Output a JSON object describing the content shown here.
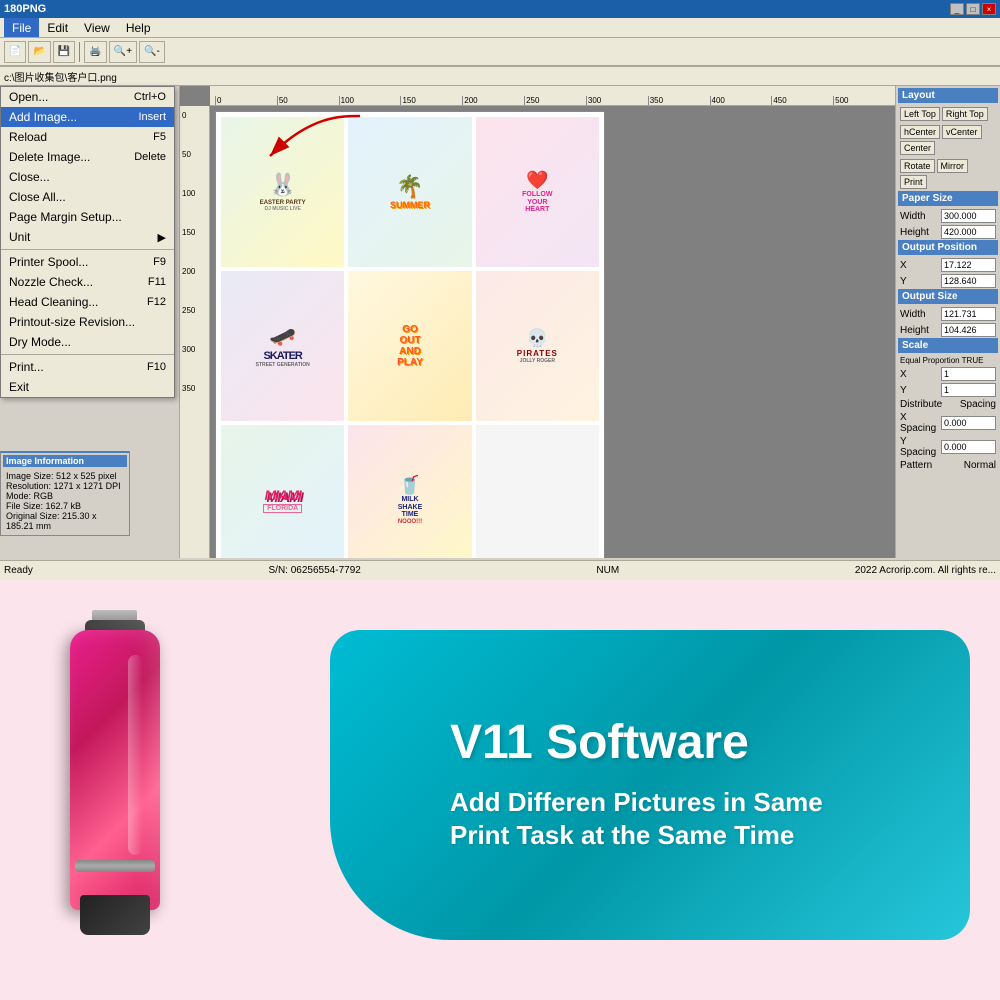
{
  "app": {
    "title": "180PNG",
    "window_controls": [
      "_",
      "□",
      "×"
    ]
  },
  "menu": {
    "items": [
      "File",
      "Edit",
      "View",
      "Help"
    ],
    "active": "File"
  },
  "dropdown": {
    "items": [
      {
        "label": "Open...",
        "shortcut": "Ctrl+O"
      },
      {
        "label": "Add Image...",
        "shortcut": "Insert",
        "highlighted": true
      },
      {
        "label": "Reload",
        "shortcut": "F5"
      },
      {
        "label": "Delete Image...",
        "shortcut": "Delete"
      },
      {
        "label": "Close...",
        "shortcut": ""
      },
      {
        "label": "Close All...",
        "shortcut": ""
      },
      {
        "label": "Page Margin Setup...",
        "shortcut": ""
      },
      {
        "label": "Unit",
        "shortcut": "▶"
      },
      {
        "separator": true
      },
      {
        "label": "Printer Spool...",
        "shortcut": "F9"
      },
      {
        "label": "Nozzle Check...",
        "shortcut": "F11"
      },
      {
        "label": "Head Cleaning...",
        "shortcut": "F12"
      },
      {
        "label": "Printout-size Revision...",
        "shortcut": ""
      },
      {
        "label": "Dry Mode...",
        "shortcut": ""
      },
      {
        "separator": true
      },
      {
        "label": "Print...",
        "shortcut": "F10"
      },
      {
        "label": "Exit",
        "shortcut": ""
      }
    ]
  },
  "right_panel": {
    "layout_section": "Layout",
    "layout_buttons": [
      "Left Top",
      "Right Top"
    ],
    "layout_buttons2": [
      "hCenter",
      "vCenter",
      "Center"
    ],
    "layout_buttons3": [
      "Rotate",
      "Mirror",
      "Print"
    ],
    "paper_size": {
      "label": "Paper Size",
      "width_label": "Width",
      "width_val": "300.000",
      "height_label": "Height",
      "height_val": "420.000"
    },
    "output_position": {
      "label": "Output Position",
      "x_label": "X",
      "x_val": "17.122",
      "y_label": "Y",
      "y_val": "128.640"
    },
    "output_size": {
      "label": "Output Size",
      "width_label": "Width",
      "width_val": "121.731",
      "height_label": "Height",
      "height_val": "104.426"
    },
    "scale_section": "Scale",
    "equal_prop": "Equal Proportion TRUE",
    "scale_x": "1",
    "scale_y": "1",
    "distribute": "Distribute",
    "spacing": "Spacing",
    "x_spacing": "0.000",
    "y_spacing": "0.000",
    "pattern": "Pattern",
    "pattern_val": "Normal"
  },
  "image_info": {
    "title": "Image Information",
    "image_size": "512 x 525 pixel",
    "resolution": "1271 x 1271 DPI",
    "mode": "RGB",
    "file_size": "162.7 kB",
    "original_size": "215.30 x 185.21 mm"
  },
  "status_bar": {
    "ready": "Ready",
    "serial": "S/N: 06256554-7792",
    "num": "NUM",
    "copyright": "2022 Acrorip.com. All rights re..."
  },
  "canvas_images": [
    {
      "id": "easter",
      "label": "EASTER PARTY",
      "color": "easter-bunny"
    },
    {
      "id": "summer",
      "label": "SUMMER",
      "color": "summer"
    },
    {
      "id": "follow",
      "label": "FOLLOW YOUR HEART",
      "color": "follow-heart"
    },
    {
      "id": "skater",
      "label": "SKATER",
      "color": "skater"
    },
    {
      "id": "go-out",
      "label": "GO OUT AND PLAY",
      "color": "go-out"
    },
    {
      "id": "pirates",
      "label": "PIRATES",
      "color": "pirates"
    },
    {
      "id": "miami",
      "label": "MIAMI FLORIDA",
      "color": "miami"
    },
    {
      "id": "milkshake",
      "label": "MILK SHAKE TIME",
      "color": "milkshake"
    },
    {
      "id": "empty",
      "label": "",
      "color": ""
    }
  ],
  "marketing": {
    "title": "V11 Software",
    "subtitle": "Add Differen Pictures in Same\nPrint Task at the Same Time"
  }
}
